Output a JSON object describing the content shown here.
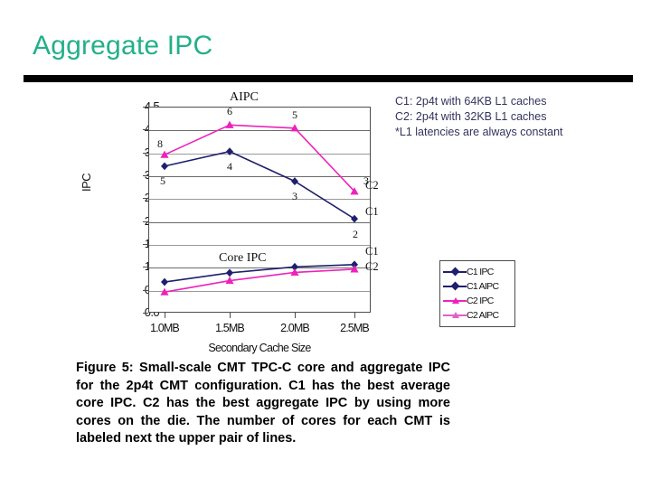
{
  "slide": {
    "title": "Aggregate IPC"
  },
  "config_note": {
    "lines": [
      "C1: 2p4t with 64KB L1 caches",
      "C2: 2p4t with 32KB L1 caches",
      "*L1 latencies are always constant"
    ]
  },
  "legend": {
    "items": [
      {
        "label": "C1 IPC",
        "color": "#1f1f6e",
        "marker": "diamond"
      },
      {
        "label": "C1 AIPC",
        "color": "#1f1f6e",
        "marker": "diamond"
      },
      {
        "label": "C2 IPC",
        "color": "#ee22bb",
        "marker": "triangle"
      },
      {
        "label": "C2 AIPC",
        "color": "#e060c8",
        "marker": "triangle"
      }
    ]
  },
  "caption": {
    "text": "Figure 5: Small-scale CMT TPC-C core and aggregate IPC for the 2p4t CMT configuration. C1 has the best average core IPC. C2 has the best aggregate IPC by using more cores on the die. The number of cores for each CMT is labeled next the upper pair of lines."
  },
  "chart_data": {
    "type": "line",
    "title": "",
    "xlabel": "Secondary Cache Size",
    "ylabel": "IPC",
    "categories": [
      "1.0MB",
      "1.5MB",
      "2.0MB",
      "2.5MB"
    ],
    "ylim": [
      0.0,
      4.5
    ],
    "yticks": [
      "0.0",
      "0.5",
      "1.0",
      "1.5",
      "2.0",
      "2.5",
      "3.0",
      "3.5",
      "4.0",
      "4.5"
    ],
    "grid": true,
    "legend_position": "right",
    "group_labels": [
      {
        "id": "aipc",
        "text": "AIPC"
      },
      {
        "id": "core",
        "text": "Core IPC"
      }
    ],
    "edge_labels": [
      {
        "text": "C2",
        "series": "C2 AIPC"
      },
      {
        "text": "C1",
        "series": "C1 AIPC"
      },
      {
        "text": "C1",
        "series": "C1 IPC"
      },
      {
        "text": "C2",
        "series": "C2 IPC"
      }
    ],
    "core_count_labels": {
      "C1 AIPC": [
        "5",
        "4",
        "3",
        "2"
      ],
      "C2 AIPC": [
        "8",
        "6",
        "5",
        "3"
      ]
    },
    "series": [
      {
        "name": "C1 AIPC",
        "color": "#1f1f6e",
        "marker": "diamond",
        "values": [
          3.2,
          3.52,
          2.87,
          2.05
        ]
      },
      {
        "name": "C2 AIPC",
        "color": "#ee22bb",
        "marker": "triangle",
        "values": [
          3.45,
          4.1,
          4.03,
          2.65
        ]
      },
      {
        "name": "C1 IPC",
        "color": "#1f1f6e",
        "marker": "diamond",
        "values": [
          0.67,
          0.87,
          1.0,
          1.05
        ]
      },
      {
        "name": "C2 IPC",
        "color": "#ee22bb",
        "marker": "triangle",
        "values": [
          0.45,
          0.7,
          0.88,
          0.95
        ]
      }
    ]
  }
}
